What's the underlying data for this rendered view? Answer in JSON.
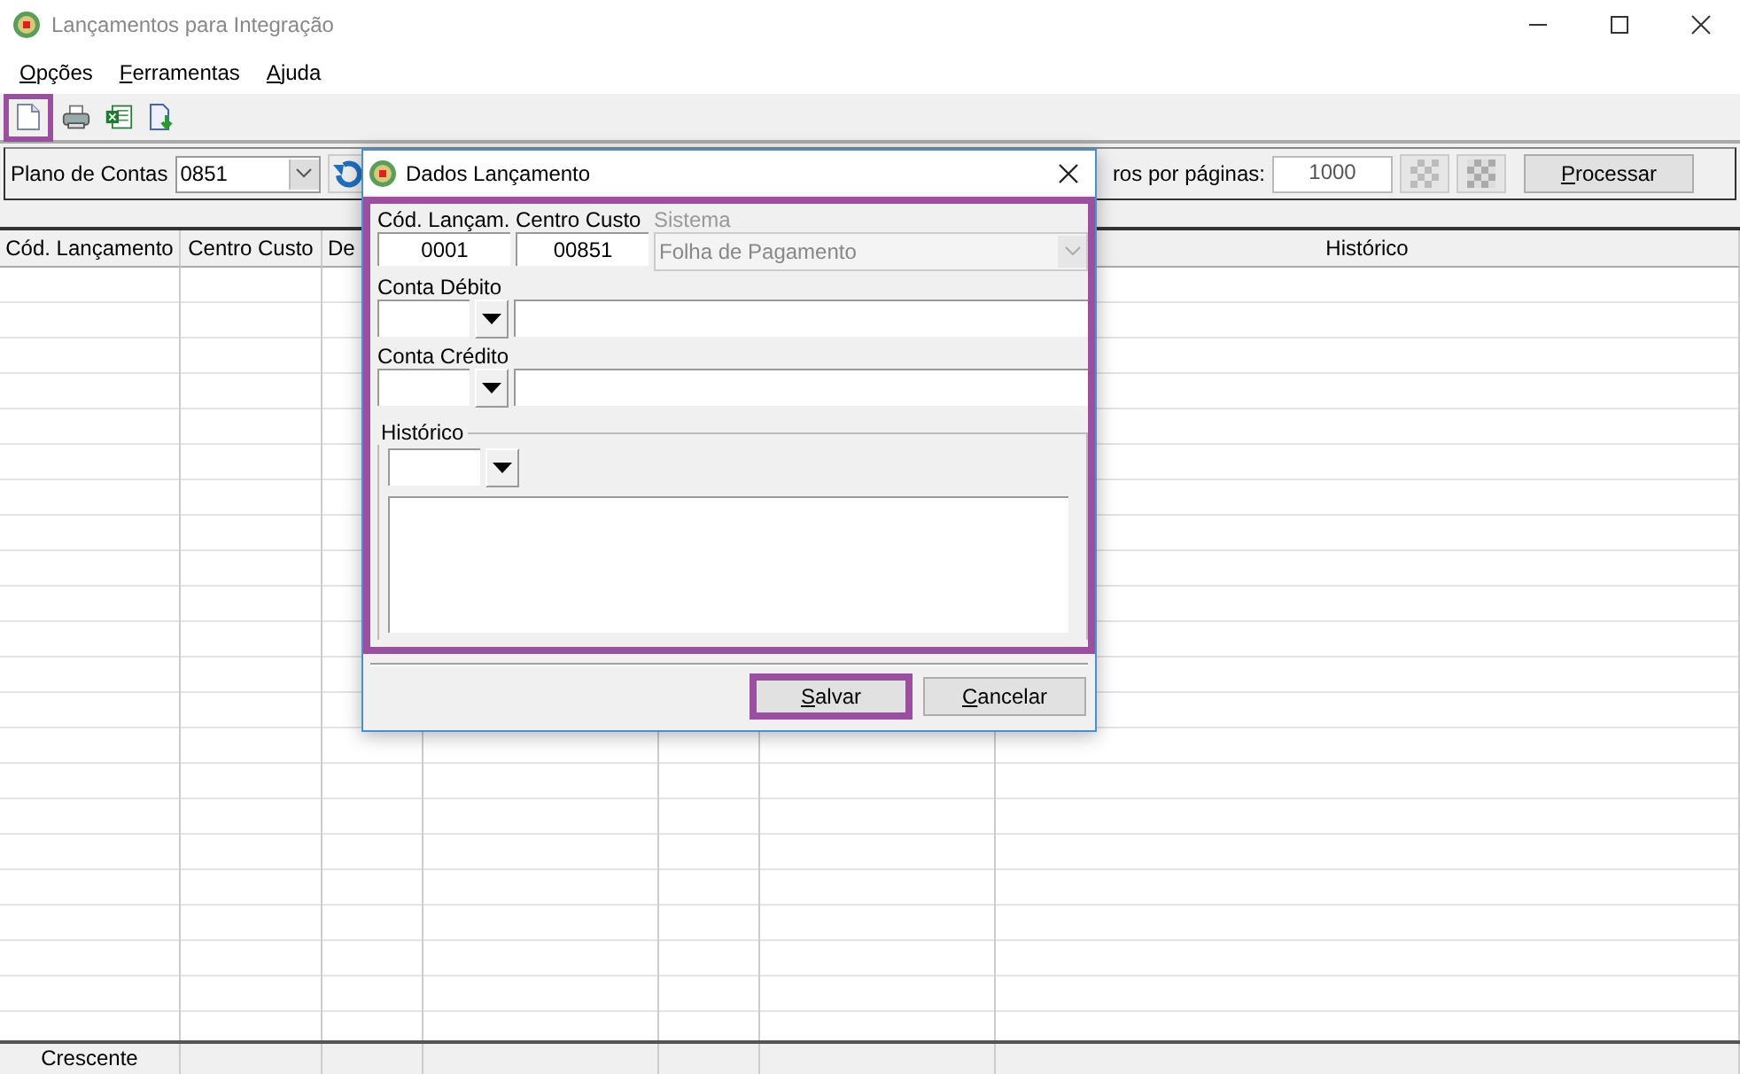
{
  "window": {
    "title": "Lançamentos para Integração"
  },
  "menu": [
    {
      "label": "Opções"
    },
    {
      "label": "Ferramentas"
    },
    {
      "label": "Ajuda"
    }
  ],
  "toolbar": [
    {
      "kind": "new",
      "highlighted": true
    },
    {
      "kind": "print",
      "highlighted": false
    },
    {
      "kind": "excel",
      "highlighted": false
    },
    {
      "kind": "import",
      "highlighted": false
    }
  ],
  "filter": {
    "plan_label": "Plano de Contas",
    "plan_value": "0851",
    "per_page_label": "ros por páginas:",
    "per_page_value": "1000",
    "process_button": "Processar"
  },
  "table": {
    "columns": [
      {
        "label": "Cód. Lançamento"
      },
      {
        "label": "Centro Custo"
      },
      {
        "label": "De"
      },
      {},
      {},
      {},
      {
        "label": "Histórico"
      }
    ],
    "footer": [
      "Crescente"
    ]
  },
  "dialog": {
    "title": "Dados Lançamento",
    "form_highlighted": true,
    "cod_label": "Cód. Lançam.",
    "cod_value": "0001",
    "centro_label": "Centro Custo",
    "centro_value": "00851",
    "sistema_label": "Sistema",
    "sistema_value": "Folha de Pagamento",
    "sistema_disabled": true,
    "debito_label": "Conta Débito",
    "credito_label": "Conta Crédito",
    "historico_label": "Histórico",
    "buttons": [
      {
        "label": "Salvar",
        "highlighted": true
      },
      {
        "label": "Cancelar",
        "highlighted": false
      }
    ]
  }
}
